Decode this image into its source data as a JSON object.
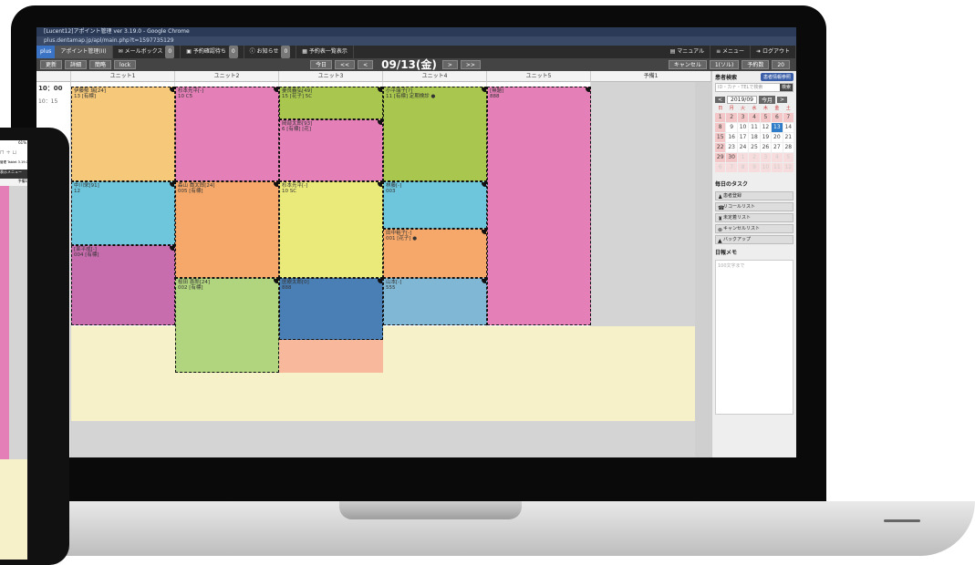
{
  "window": {
    "title": "[Lucent12]アポイント管理 ver 3.19.0 - Google Chrome",
    "url": "plus.dentamap.jp/apl/main.php?t=1597735129"
  },
  "menubar": {
    "logo": "plus",
    "appointment": "アポイント管理(II)",
    "mailbox": "メールボックス",
    "mailbox_count": "0",
    "schedule": "予約確認待ち",
    "schedule_count": "0",
    "notice": "お知らせ",
    "notice_count": "0",
    "list": "予約表一覧表示",
    "manual": "マニュアル",
    "menu": "メニュー",
    "logout": "ログアウト"
  },
  "toolbar": {
    "buttons": [
      "更新",
      "詳細",
      "簡略",
      "lock"
    ],
    "today": "今日",
    "prev2": "<<",
    "prev": "<",
    "date": "09/13(金)",
    "next": ">",
    "next2": ">>",
    "right": [
      "キャンセル",
      "1(ソル)",
      "予約数",
      "20"
    ]
  },
  "columns": [
    "ユニット1",
    "ユニット2",
    "ユニット3",
    "ユニット4",
    "ユニット5",
    "予備1"
  ],
  "times": [
    "10：00",
    "10：15"
  ],
  "appointments": [
    {
      "col": 0,
      "label": "伊藤郁 瑞[24]",
      "sub": "13 [有標]",
      "color": "#f5c87a"
    },
    {
      "col": 1,
      "label": "杉本光平[-]",
      "sub": "10 C5",
      "color": "#e47fb7"
    },
    {
      "col": 2,
      "label": "妻良義弘[49]",
      "sub": "15 [花子] 5C",
      "color": "#a9c74e"
    },
    {
      "col": 2,
      "label": "岡部太郎[93]",
      "sub": "6 [有標] [花]",
      "color": "#e47fb7"
    },
    {
      "col": 3,
      "label": "小平瑞子[?]",
      "sub": "11 [有標] 定期検診 ●",
      "color": "#a9c74e"
    },
    {
      "col": 4,
      "label": "[無題]",
      "sub": "888",
      "color": "#e47fb7"
    },
    {
      "col": 0,
      "label": "中川栄[91]",
      "sub": "12",
      "color": "#6ec6dc"
    },
    {
      "col": 1,
      "label": "森山 喬太郎[24]",
      "sub": "005 [有標]",
      "color": "#f5a86a"
    },
    {
      "col": 2,
      "label": "杉本光平[-]",
      "sub": "10 SC",
      "color": "#eaea7a"
    },
    {
      "col": 3,
      "label": "林藤[-]",
      "sub": "003",
      "color": "#6ec6dc"
    },
    {
      "col": 3,
      "label": "田中裕子[-]",
      "sub": "001 [花子] ●",
      "color": "#f5a86a"
    },
    {
      "col": 0,
      "label": "[某平成[-]",
      "sub": "004 [有標]",
      "color": "#c76dae"
    },
    {
      "col": 1,
      "label": "桜田 喜郎[24]",
      "sub": "002 [有標]",
      "color": "#b1d47e"
    },
    {
      "col": 2,
      "label": "医療太郎[0]",
      "sub": "888",
      "color": "#4a7fb5"
    },
    {
      "col": 3,
      "label": "山本[-]",
      "sub": "555",
      "color": "#7fb7d4"
    }
  ],
  "right_panel": {
    "search_title": "患者検索",
    "search_btn": "患者情報参照",
    "search_placeholder": "ID・カナ・TELで検索",
    "search_go": "検索",
    "cal_prev": "<",
    "cal_month": "2019/09",
    "cal_today": "今月",
    "cal_next": ">",
    "cal_heads": [
      "日",
      "月",
      "火",
      "水",
      "木",
      "金",
      "土"
    ],
    "cal_days": [
      "1",
      "2",
      "3",
      "4",
      "5",
      "6",
      "7",
      "8",
      "9",
      "10",
      "11",
      "12",
      "13",
      "14",
      "15",
      "16",
      "17",
      "18",
      "19",
      "20",
      "21",
      "22",
      "23",
      "24",
      "25",
      "26",
      "27",
      "28",
      "29",
      "30",
      "1",
      "2",
      "3",
      "4",
      "5",
      "6",
      "7",
      "8",
      "9",
      "10",
      "11",
      "12"
    ],
    "task_title": "毎日のタスク",
    "tasks": [
      "患者登録",
      "リコールリスト",
      "未定着リスト",
      "キャンセルリスト",
      "バックアップ"
    ],
    "memo_title": "日報メモ",
    "memo_placeholder": "100文字まで"
  },
  "tablet": {
    "status": "61%",
    "title": "管理 Tablet 3.19.0",
    "tab": "表示",
    "menu": "メニュー",
    "col": "予備1"
  }
}
